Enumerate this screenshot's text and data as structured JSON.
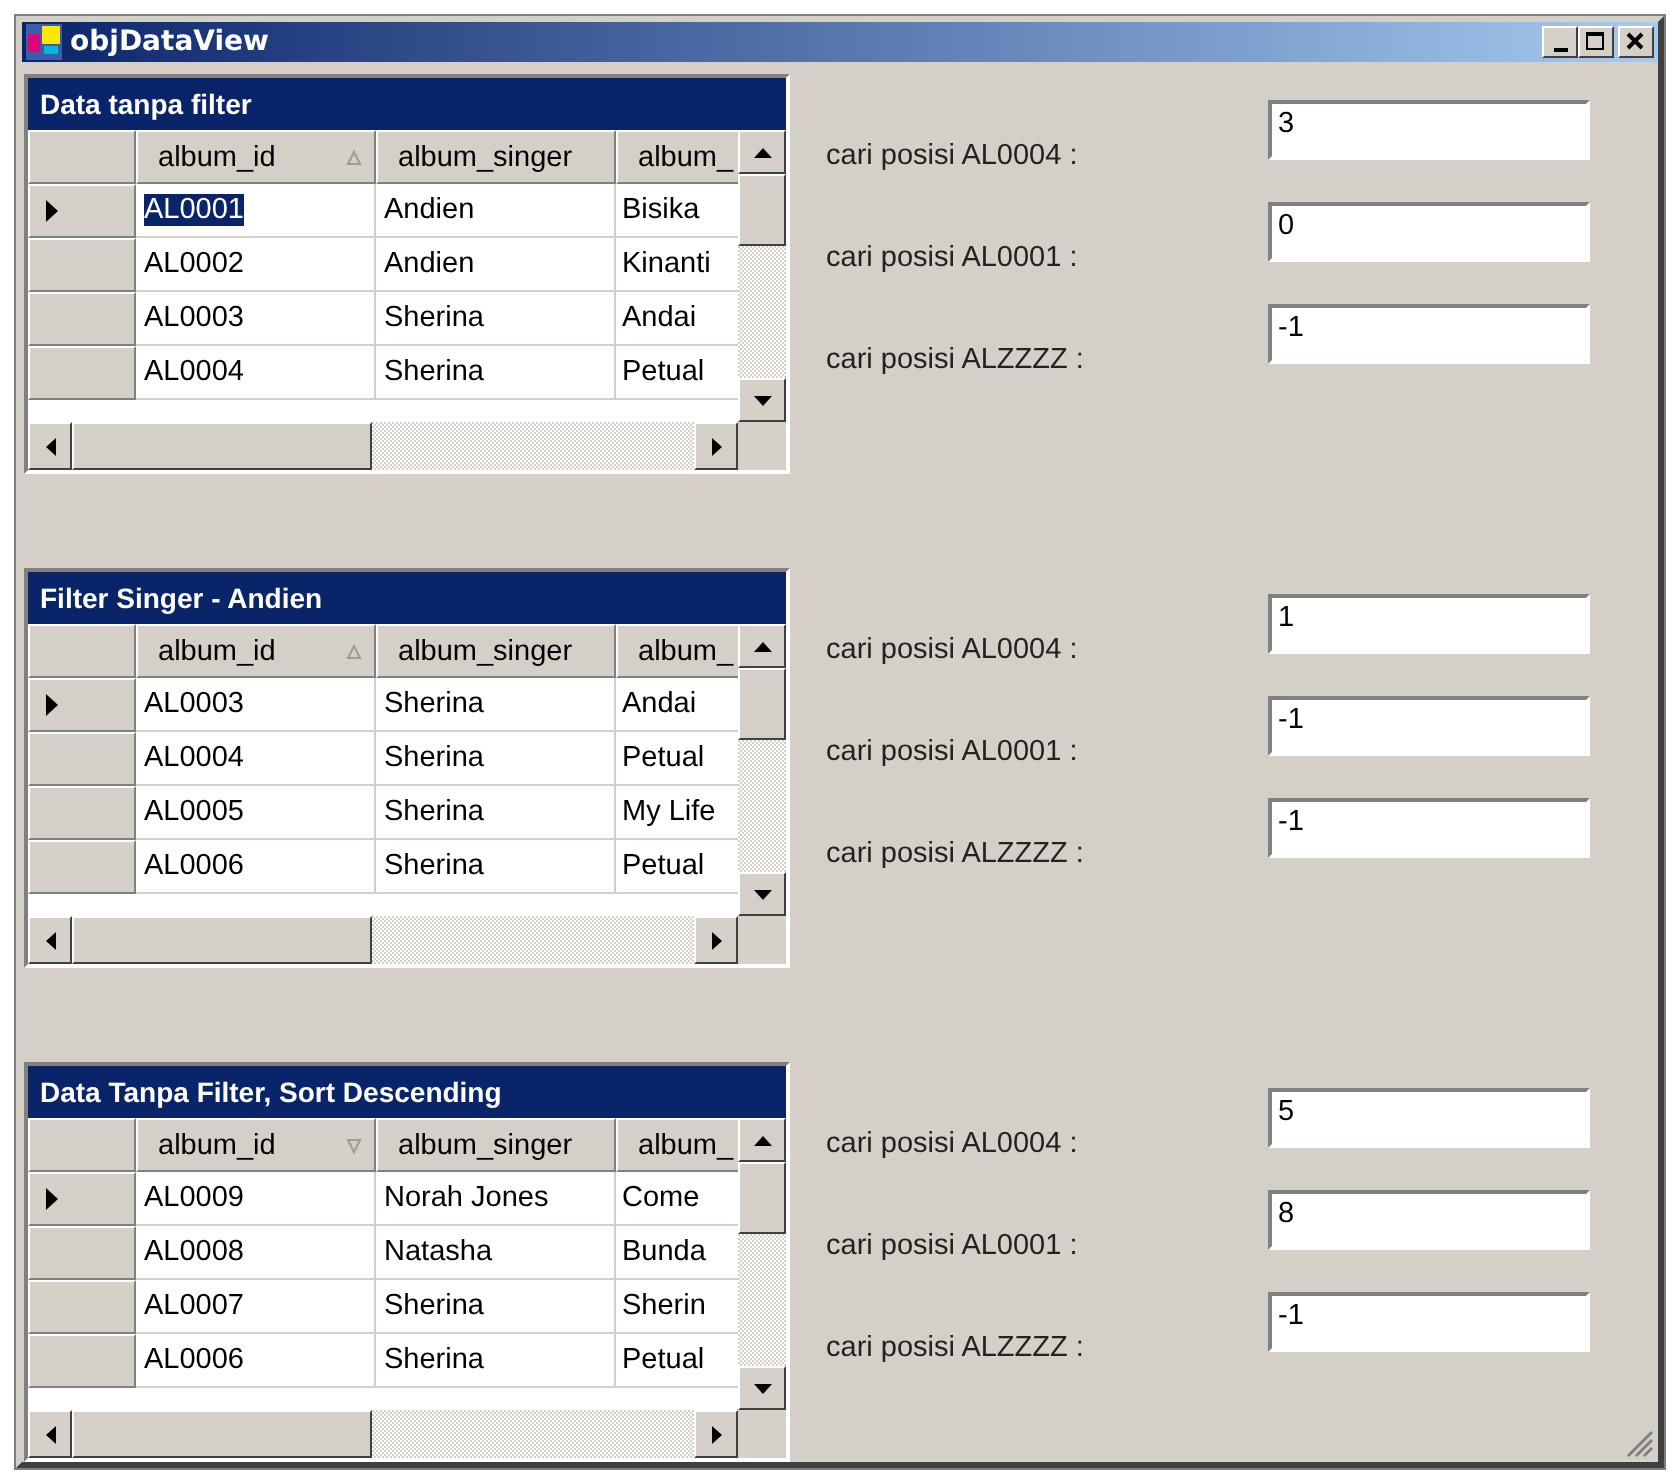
{
  "window": {
    "title": "objDataView"
  },
  "sections": [
    {
      "grid": {
        "caption": "Data tanpa filter",
        "focus_cell_highlighted": true,
        "columns": [
          {
            "label": "album_id",
            "sorted": true,
            "descending": false
          },
          {
            "label": "album_singer",
            "sorted": false
          },
          {
            "label": "album_",
            "sorted": false
          }
        ],
        "rows": [
          {
            "selected": true,
            "cells": [
              "AL0001",
              "Andien",
              "Bisika"
            ]
          },
          {
            "selected": false,
            "cells": [
              "AL0002",
              "Andien",
              "Kinanti"
            ]
          },
          {
            "selected": false,
            "cells": [
              "AL0003",
              "Sherina",
              "Andai"
            ]
          },
          {
            "selected": false,
            "cells": [
              "AL0004",
              "Sherina",
              "Petual"
            ]
          }
        ]
      },
      "fields": [
        {
          "label": "cari posisi AL0004 :",
          "value": "3"
        },
        {
          "label": "cari posisi AL0001 :",
          "value": "0"
        },
        {
          "label": "cari posisi ALZZZZ :",
          "value": "-1"
        }
      ]
    },
    {
      "grid": {
        "caption": "Filter Singer - Andien",
        "focus_cell_highlighted": false,
        "columns": [
          {
            "label": "album_id",
            "sorted": true,
            "descending": false
          },
          {
            "label": "album_singer",
            "sorted": false
          },
          {
            "label": "album_",
            "sorted": false
          }
        ],
        "rows": [
          {
            "selected": true,
            "cells": [
              "AL0003",
              "Sherina",
              "Andai"
            ]
          },
          {
            "selected": false,
            "cells": [
              "AL0004",
              "Sherina",
              "Petual"
            ]
          },
          {
            "selected": false,
            "cells": [
              "AL0005",
              "Sherina",
              "My Life"
            ]
          },
          {
            "selected": false,
            "cells": [
              "AL0006",
              "Sherina",
              "Petual"
            ]
          }
        ]
      },
      "fields": [
        {
          "label": "cari posisi AL0004 :",
          "value": "1"
        },
        {
          "label": "cari posisi AL0001 :",
          "value": "-1"
        },
        {
          "label": "cari posisi ALZZZZ :",
          "value": "-1"
        }
      ]
    },
    {
      "grid": {
        "caption": "Data Tanpa Filter, Sort Descending",
        "focus_cell_highlighted": false,
        "columns": [
          {
            "label": "album_id",
            "sorted": true,
            "descending": true
          },
          {
            "label": "album_singer",
            "sorted": false
          },
          {
            "label": "album_",
            "sorted": false
          }
        ],
        "rows": [
          {
            "selected": true,
            "cells": [
              "AL0009",
              "Norah Jones",
              "Come"
            ]
          },
          {
            "selected": false,
            "cells": [
              "AL0008",
              "Natasha",
              "Bunda"
            ]
          },
          {
            "selected": false,
            "cells": [
              "AL0007",
              "Sherina",
              "Sherin"
            ]
          },
          {
            "selected": false,
            "cells": [
              "AL0006",
              "Sherina",
              "Petual"
            ]
          }
        ]
      },
      "fields": [
        {
          "label": "cari posisi AL0004 :",
          "value": "5"
        },
        {
          "label": "cari posisi AL0001 :",
          "value": "8"
        },
        {
          "label": "cari posisi ALZZZZ :",
          "value": "-1"
        }
      ]
    }
  ]
}
